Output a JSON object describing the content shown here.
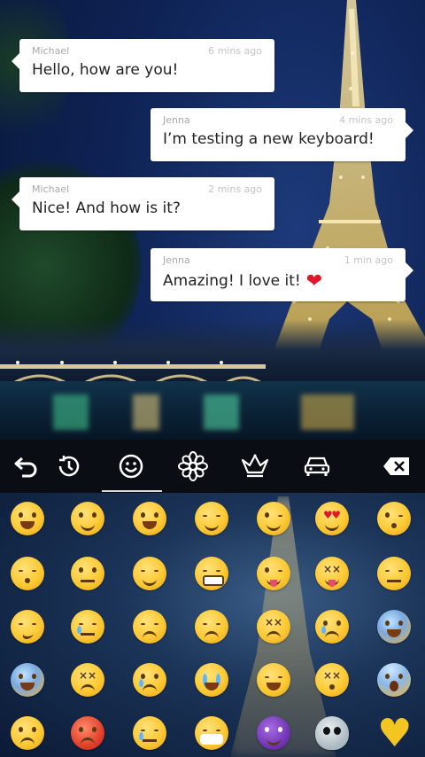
{
  "messages": [
    {
      "sender": "Michael",
      "time": "6 mins ago",
      "text": "Hello, how are you!",
      "side": "left"
    },
    {
      "sender": "Jenna",
      "time": "4 mins ago",
      "text": "I’m testing a new keyboard!",
      "side": "right"
    },
    {
      "sender": "Michael",
      "time": "2 mins ago",
      "text": "Nice! And how is it?",
      "side": "left"
    },
    {
      "sender": "Jenna",
      "time": "1 min ago",
      "text": "Amazing! I love it!",
      "side": "right"
    }
  ],
  "toolbar": {
    "tabs": [
      {
        "icon": "back-arrow-icon"
      },
      {
        "icon": "recent-clock-icon"
      },
      {
        "icon": "smiley-icon",
        "selected": true
      },
      {
        "icon": "flower-icon"
      },
      {
        "icon": "crown-icon"
      },
      {
        "icon": "car-icon"
      },
      {
        "icon": "backspace-icon"
      }
    ]
  },
  "emoji_rows": [
    [
      "grinning",
      "smiling-blush",
      "smiley-open",
      "relaxed",
      "winking",
      "heart-eyes",
      "kissing-heart"
    ],
    [
      "kissing-closed-eyes",
      "flushed",
      "relieved",
      "grimacing",
      "stuck-out-tongue-wink",
      "stuck-out-tongue-closed",
      "unamused"
    ],
    [
      "smirking",
      "sweat",
      "pensive",
      "disappointed",
      "confounded",
      "crying",
      "cold-sweat"
    ],
    [
      "fearful",
      "tired",
      "crying-tear",
      "sobbing",
      "joy",
      "dizzy",
      "screaming"
    ],
    [
      "angry",
      "pouting",
      "sleepy",
      "mask",
      "imp",
      "alien",
      "yellow-heart"
    ]
  ],
  "colors": {
    "bubble": "#ffffff",
    "toolbar": "#0a0d14",
    "heart": "#e0172a"
  }
}
